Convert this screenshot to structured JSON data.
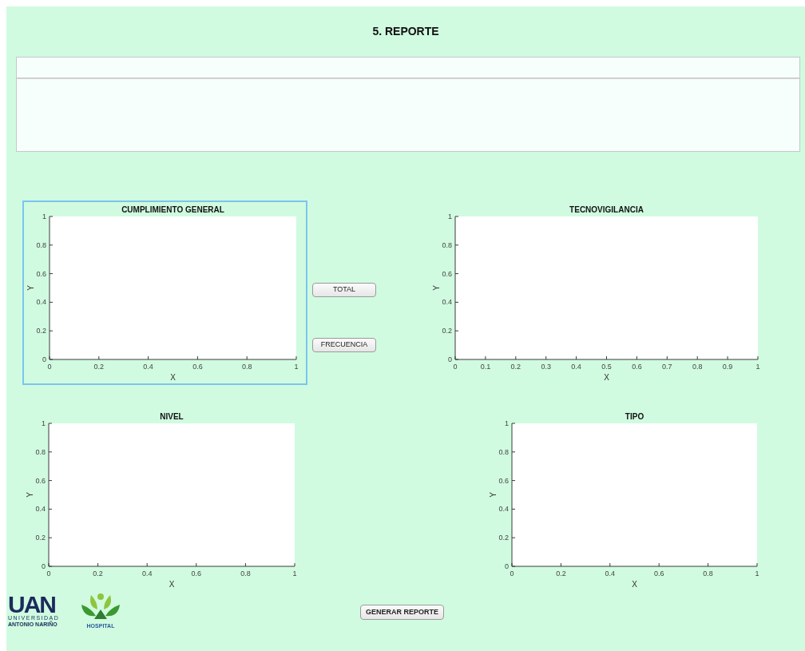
{
  "title": "5. REPORTE",
  "charts": [
    {
      "selected": true,
      "chart_data": {
        "type": "line",
        "title": "CUMPLIMIENTO GENERAL",
        "xlabel": "X",
        "ylabel": "Y",
        "xlim": [
          0,
          1
        ],
        "ylim": [
          0,
          1
        ],
        "xticks": [
          {
            "value": 0,
            "label": "0"
          },
          {
            "value": 0.2,
            "label": "0.2"
          },
          {
            "value": 0.4,
            "label": "0.4"
          },
          {
            "value": 0.6,
            "label": "0.6"
          },
          {
            "value": 0.8,
            "label": "0.8"
          },
          {
            "value": 1,
            "label": "1"
          }
        ],
        "yticks": [
          {
            "value": 0,
            "label": "0"
          },
          {
            "value": 0.2,
            "label": "0.2"
          },
          {
            "value": 0.4,
            "label": "0.4"
          },
          {
            "value": 0.6,
            "label": "0.6"
          },
          {
            "value": 0.8,
            "label": "0.8"
          },
          {
            "value": 1,
            "label": "1"
          }
        ]
      }
    },
    {
      "selected": false,
      "chart_data": {
        "type": "line",
        "title": "TECNOVIGILANCIA",
        "xlabel": "X",
        "ylabel": "Y",
        "xlim": [
          0,
          1
        ],
        "ylim": [
          0,
          1
        ],
        "xticks": [
          {
            "value": 0,
            "label": "0"
          },
          {
            "value": 0.1,
            "label": "0.1"
          },
          {
            "value": 0.2,
            "label": "0.2"
          },
          {
            "value": 0.3,
            "label": "0.3"
          },
          {
            "value": 0.4,
            "label": "0.4"
          },
          {
            "value": 0.5,
            "label": "0.5"
          },
          {
            "value": 0.6,
            "label": "0.6"
          },
          {
            "value": 0.7,
            "label": "0.7"
          },
          {
            "value": 0.8,
            "label": "0.8"
          },
          {
            "value": 0.9,
            "label": "0.9"
          },
          {
            "value": 1,
            "label": "1"
          }
        ],
        "yticks": [
          {
            "value": 0,
            "label": "0"
          },
          {
            "value": 0.2,
            "label": "0.2"
          },
          {
            "value": 0.4,
            "label": "0.4"
          },
          {
            "value": 0.6,
            "label": "0.6"
          },
          {
            "value": 0.8,
            "label": "0.8"
          },
          {
            "value": 1,
            "label": "1"
          }
        ]
      }
    },
    {
      "selected": false,
      "chart_data": {
        "type": "line",
        "title": "NIVEL",
        "xlabel": "X",
        "ylabel": "Y",
        "xlim": [
          0,
          1
        ],
        "ylim": [
          0,
          1
        ],
        "xticks": [
          {
            "value": 0,
            "label": "0"
          },
          {
            "value": 0.2,
            "label": "0.2"
          },
          {
            "value": 0.4,
            "label": "0.4"
          },
          {
            "value": 0.6,
            "label": "0.6"
          },
          {
            "value": 0.8,
            "label": "0.8"
          },
          {
            "value": 1,
            "label": "1"
          }
        ],
        "yticks": [
          {
            "value": 0,
            "label": "0"
          },
          {
            "value": 0.2,
            "label": "0.2"
          },
          {
            "value": 0.4,
            "label": "0.4"
          },
          {
            "value": 0.6,
            "label": "0.6"
          },
          {
            "value": 0.8,
            "label": "0.8"
          },
          {
            "value": 1,
            "label": "1"
          }
        ]
      }
    },
    {
      "selected": false,
      "chart_data": {
        "type": "line",
        "title": "TIPO",
        "xlabel": "X",
        "ylabel": "Y",
        "xlim": [
          0,
          1
        ],
        "ylim": [
          0,
          1
        ],
        "xticks": [
          {
            "value": 0,
            "label": "0"
          },
          {
            "value": 0.2,
            "label": "0.2"
          },
          {
            "value": 0.4,
            "label": "0.4"
          },
          {
            "value": 0.6,
            "label": "0.6"
          },
          {
            "value": 0.8,
            "label": "0.8"
          },
          {
            "value": 1,
            "label": "1"
          }
        ],
        "yticks": [
          {
            "value": 0,
            "label": "0"
          },
          {
            "value": 0.2,
            "label": "0.2"
          },
          {
            "value": 0.4,
            "label": "0.4"
          },
          {
            "value": 0.6,
            "label": "0.6"
          },
          {
            "value": 0.8,
            "label": "0.8"
          },
          {
            "value": 1,
            "label": "1"
          }
        ]
      }
    }
  ],
  "side_buttons": [
    "TOTAL",
    "FRECUENCIA"
  ],
  "generate_button": "GENERAR REPORTE",
  "logos": {
    "uan": {
      "mark": "UAN",
      "line1": "UNIVERSIDAD",
      "line2": "ANTONIO NARIÑO"
    },
    "hospital": {
      "label": "HOSPITAL"
    }
  }
}
